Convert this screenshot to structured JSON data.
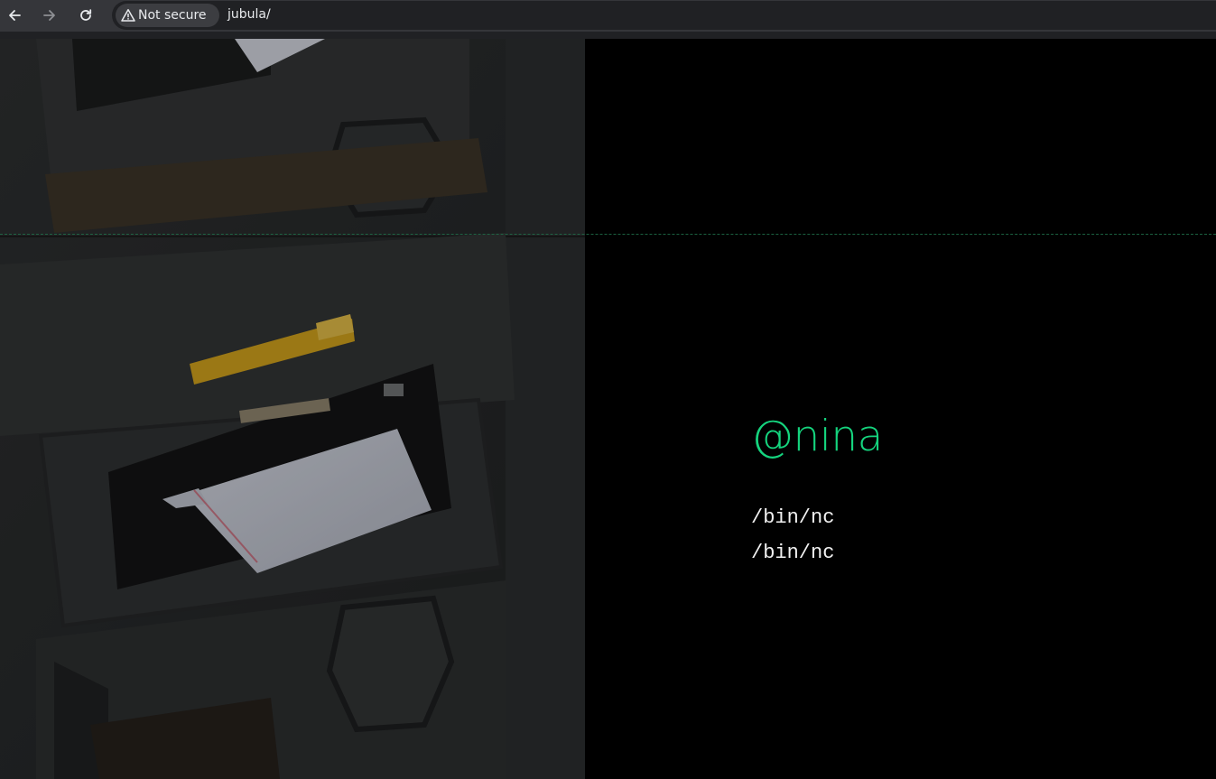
{
  "browser": {
    "security_label": "Not secure",
    "url": "jubula/",
    "icons": {
      "back": "arrow-left-icon",
      "forward": "arrow-right-icon",
      "reload": "reload-icon",
      "warning": "warning-triangle-icon"
    }
  },
  "page": {
    "handle": "@nina",
    "shells": [
      "/bin/nc",
      "/bin/nc"
    ],
    "colors": {
      "background": "#000000",
      "accent": "#15d47e",
      "text": "#f2f2f2"
    },
    "hero_image": "mailbox-with-letter-photo"
  }
}
